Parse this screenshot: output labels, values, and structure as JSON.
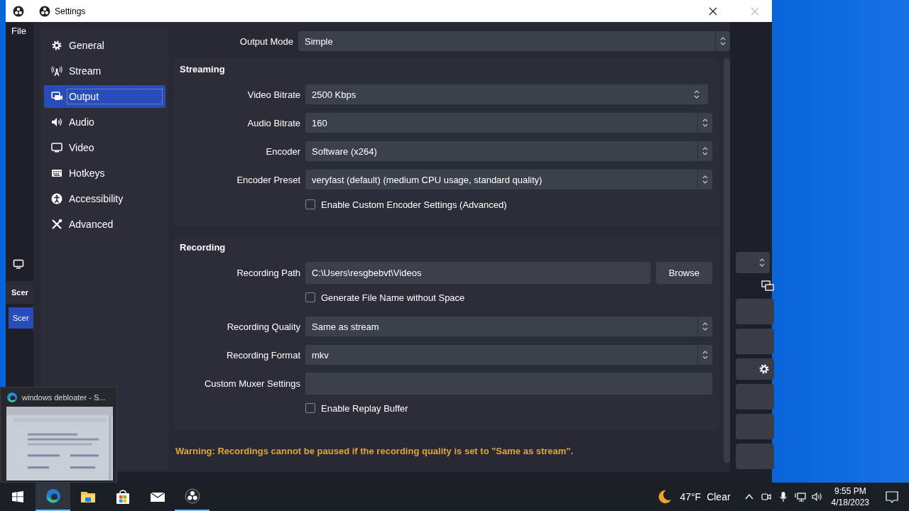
{
  "background_window": {
    "menu": [
      "File"
    ],
    "scenes_header": "Scer",
    "scene_item": {
      "label": "Scer",
      "selected": true
    }
  },
  "settings": {
    "title": "Settings",
    "nav": [
      {
        "label": "General",
        "selected": false
      },
      {
        "label": "Stream",
        "selected": false
      },
      {
        "label": "Output",
        "selected": true
      },
      {
        "label": "Audio",
        "selected": false
      },
      {
        "label": "Video",
        "selected": false
      },
      {
        "label": "Hotkeys",
        "selected": false
      },
      {
        "label": "Accessibility",
        "selected": false
      },
      {
        "label": "Advanced",
        "selected": false
      }
    ],
    "output_mode": {
      "label": "Output Mode",
      "value": "Simple"
    },
    "sections": [
      {
        "title": "Streaming",
        "rows": [
          {
            "kind": "spin",
            "label": "Video Bitrate",
            "value": "2500 Kbps"
          },
          {
            "kind": "select",
            "label": "Audio Bitrate",
            "value": "160"
          },
          {
            "kind": "select",
            "label": "Encoder",
            "value": "Software (x264)"
          },
          {
            "kind": "select",
            "label": "Encoder Preset",
            "value": "veryfast (default) (medium CPU usage, standard quality)"
          },
          {
            "kind": "checkbox",
            "label": "Enable Custom Encoder Settings (Advanced)",
            "checked": false
          }
        ]
      },
      {
        "title": "Recording",
        "rows": [
          {
            "kind": "path",
            "label": "Recording Path",
            "value": "C:\\Users\\resgbebvt\\Videos",
            "button": "Browse"
          },
          {
            "kind": "checkbox",
            "label": "Generate File Name without Space",
            "checked": false
          },
          {
            "kind": "select",
            "label": "Recording Quality",
            "value": "Same as stream"
          },
          {
            "kind": "select",
            "label": "Recording Format",
            "value": "mkv"
          },
          {
            "kind": "text",
            "label": "Custom Muxer Settings",
            "value": ""
          },
          {
            "kind": "checkbox",
            "label": "Enable Replay Buffer",
            "checked": false
          }
        ]
      }
    ],
    "warning": "Warning: Recordings cannot be paused if the recording quality is set to \"Same as stream\"."
  },
  "preview": {
    "title": "windows debloater - S..."
  },
  "taskbar": {
    "apps": [
      {
        "running": true,
        "hovered": true
      },
      {
        "running": false,
        "hovered": false
      },
      {
        "running": false,
        "hovered": false
      },
      {
        "running": false,
        "hovered": false
      },
      {
        "running": true,
        "hovered": false
      }
    ],
    "temperature": "47°F",
    "condition": "Clear",
    "time": "9:55 PM",
    "date": "4/18/2023"
  }
}
